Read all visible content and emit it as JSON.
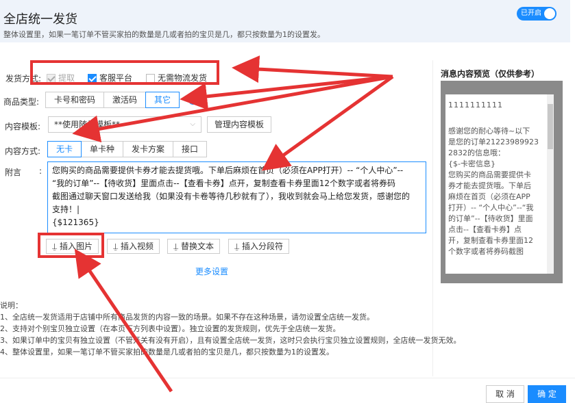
{
  "header": {
    "title": "全店统一发货",
    "subtitle": "整体设置里，如果一笔订单不管买家拍的数量是几或者拍的宝贝是几，都只按数量为1的设置发。",
    "toggle_label": "已开启"
  },
  "form": {
    "delivery_label": "发货方式:",
    "delivery_options": [
      "提取",
      "客服平台",
      "无需物流发货"
    ],
    "product_type_label": "商品类型:",
    "product_types": [
      "卡号和密码",
      "激活码",
      "其它"
    ],
    "template_label": "内容模板:",
    "template_value": "**使用随机模板**",
    "manage_template": "管理内容模板",
    "content_mode_label": "内容方式:",
    "content_modes": [
      "无卡",
      "单卡种",
      "发卡方案",
      "接口"
    ],
    "note_label": "附言",
    "note_colon": ":",
    "note_text": [
      "您购买的商品需要提供卡券才能去提货哦。下单后麻烦在首页（必须在APP打开）-- “个人中心”--",
      "“我的订单”--【待收货】里面点击--【查看卡券】点开，复制查看卡券里面12个数字或者将券码",
      "截图通过聊天窗口发送给我（如果没有卡卷等待几秒就有了），我收到就会马上给您发货，感谢您的",
      "支持！|",
      "{$121365}"
    ],
    "insert_buttons": [
      "插入图片",
      "插入视频",
      "替换文本",
      "插入分段符"
    ],
    "more_settings": "更多设置"
  },
  "preview": {
    "title": "消息内容预览（仅供参考）",
    "lines": [
      "1111111111",
      "",
      "感谢您的耐心等待~以下",
      "是您的订单21223989923",
      "2832的信息哦：",
      "{$-卡密信息}",
      "您购买的商品需要提供卡",
      "券才能去提货哦。下单后",
      "麻烦在首页（必须在APP",
      "打开）-- “个人中心”--“我",
      "的订单”--【待收货】里面",
      "点击--【查看卡券】点",
      "开，复制查看卡券里面12",
      "个数字或者将券码截图"
    ]
  },
  "notes": {
    "title": "说明：",
    "items": [
      "1、全店统一发货适用于店铺中所有商品发货的内容一致的场景。如果不存在这种场景，请勿设置全店统一发货。",
      "2、支持对个别宝贝独立设置（在本页下方列表中设置）。独立设置的发货规则，优先于全店统一发货。",
      "3、如果订单中的宝贝有独立设置（不管开关有没有开启），且有设置全店统一发货，这时只会执行宝贝独立设置规则，全店统一发货无效。",
      "4、整体设置里，如果一笔订单不管买家拍的数量是几或者拍的宝贝是几，都只按数量为1的设置发。"
    ]
  },
  "footer": {
    "cancel": "取 消",
    "ok": "确 定"
  },
  "colors": {
    "accent": "#1a8cff",
    "annotation": "#e53333"
  }
}
